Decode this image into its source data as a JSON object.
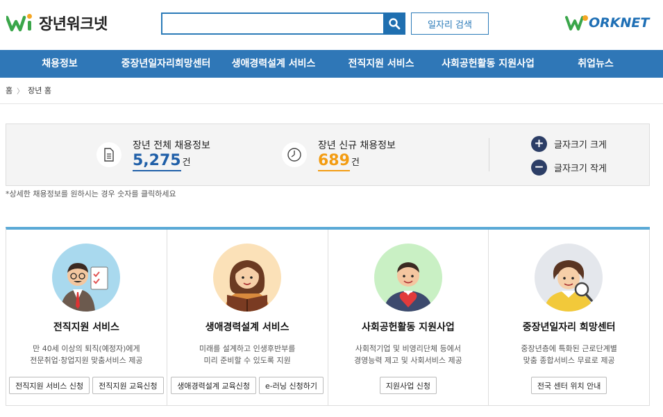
{
  "header": {
    "logo_text": "장년워크넷",
    "search_placeholder": "",
    "job_search_label": "일자리 검색",
    "worknet_text": "ORKNET"
  },
  "nav": [
    {
      "label": "채용정보"
    },
    {
      "label": "중장년일자리희망센터"
    },
    {
      "label": "생애경력설계 서비스"
    },
    {
      "label": "전직지원 서비스"
    },
    {
      "label": "사회공헌활동 지원사업"
    },
    {
      "label": "취업뉴스"
    }
  ],
  "breadcrumb": {
    "home": "홈",
    "current": "장년 홈"
  },
  "stats": {
    "total_label": "장년 전체 채용정보",
    "total_value": "5,275",
    "new_label": "장년 신규 채용정보",
    "new_value": "689",
    "unit": "건",
    "font_larger": "글자크기 크게",
    "font_smaller": "글자크기 작게",
    "note": "*상세한 채용정보를 원하시는 경우 숫자를 클릭하세요"
  },
  "colors": {
    "nav_bg": "#2f77b7",
    "total_value": "#1f5fa8",
    "new_value": "#f39c12",
    "card_border": "#5aa9d6"
  },
  "cards": [
    {
      "title": "전직지원 서비스",
      "desc1": "만 40세 이상의 퇴직(예정자)에게",
      "desc2": "전문취업·창업지원 맞춤서비스 제공",
      "btn1": "전직지원 서비스 신청",
      "btn2": "전직지원 교육신청"
    },
    {
      "title": "생애경력설계 서비스",
      "desc1": "미래를 설계하고 인생후반부를",
      "desc2": "미리 준비할 수 있도록 지원",
      "btn1": "생애경력설계 교육신청",
      "btn2": "e-러닝 신청하기"
    },
    {
      "title": "사회공헌활동 지원사업",
      "desc1": "사회적기업 및 비영리단체 등에서",
      "desc2": "경영능력 제고 및 사회서비스 제공",
      "btn1": "지원사업 신청"
    },
    {
      "title": "중장년일자리 희망센터",
      "desc1": "중장년층에 특화된 근로단계별",
      "desc2": "맞춤 종합서비스 무료로 제공",
      "btn1": "전국 센터 위치 안내"
    }
  ]
}
